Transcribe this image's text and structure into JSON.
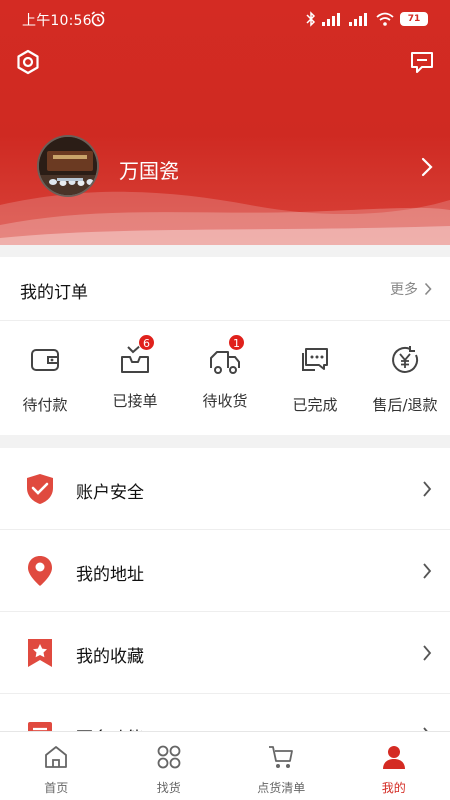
{
  "status": {
    "time": "上午10:56",
    "battery": "71"
  },
  "profile": {
    "name": "万国瓷"
  },
  "orders": {
    "title": "我的订单",
    "more": "更多",
    "items": [
      {
        "label": "待付款",
        "icon": "wallet-icon"
      },
      {
        "label": "已接单",
        "icon": "inbox-icon",
        "badge": "6"
      },
      {
        "label": "待收货",
        "icon": "truck-icon",
        "badge": "1"
      },
      {
        "label": "已完成",
        "icon": "chat-dots-icon"
      },
      {
        "label": "售后/退款",
        "icon": "yen-refund-icon"
      }
    ]
  },
  "menu": {
    "items": [
      {
        "label": "账户安全",
        "icon": "shield-check-icon"
      },
      {
        "label": "我的地址",
        "icon": "location-pin-icon"
      },
      {
        "label": "我的收藏",
        "icon": "bookmark-star-icon"
      },
      {
        "label": "更多功能",
        "icon": "list-icon"
      }
    ]
  },
  "tabs": [
    {
      "label": "首页",
      "icon": "home-icon"
    },
    {
      "label": "找货",
      "icon": "grid-icon"
    },
    {
      "label": "点货清单",
      "icon": "cart-icon"
    },
    {
      "label": "我的",
      "icon": "user-icon",
      "active": true
    }
  ],
  "colors": {
    "brand": "#d42b23",
    "badge": "#e0211c"
  }
}
